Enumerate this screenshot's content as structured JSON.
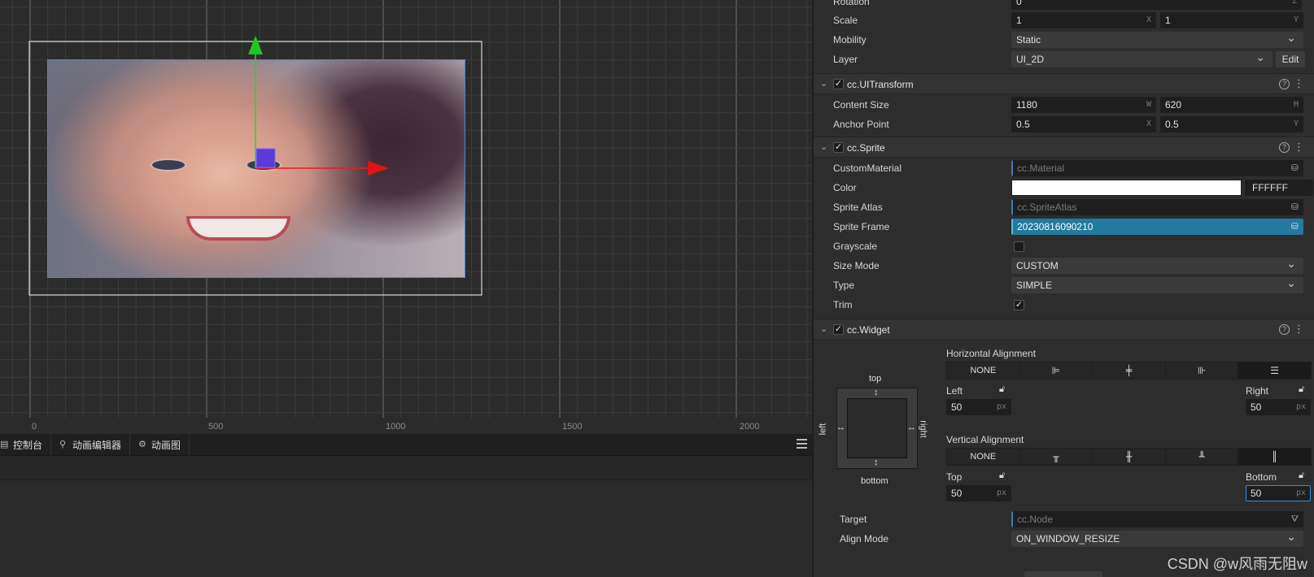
{
  "scene": {
    "ruler_labels": [
      "0",
      "500",
      "1000",
      "1500",
      "2000"
    ]
  },
  "bottom_panel": {
    "tabs": [
      {
        "label": "控制台",
        "icon": "console-icon"
      },
      {
        "label": "动画编辑器",
        "icon": "running-figure-icon"
      },
      {
        "label": "动画图",
        "icon": "animation-graph-icon"
      }
    ]
  },
  "inspector": {
    "node": {
      "rotation_label": "Rotation",
      "rotation_value": "0",
      "rotation_axis": "Z",
      "scale_label": "Scale",
      "scale_x": "1",
      "scale_y": "1",
      "mobility_label": "Mobility",
      "mobility_value": "Static",
      "layer_label": "Layer",
      "layer_value": "UI_2D",
      "layer_edit": "Edit"
    },
    "ui_transform": {
      "title": "cc.UITransform",
      "content_size_label": "Content Size",
      "width": "1180",
      "height": "620",
      "width_suffix": "W",
      "height_suffix": "H",
      "anchor_label": "Anchor Point",
      "anchor_x": "0.5",
      "anchor_y": "0.5"
    },
    "sprite": {
      "title": "cc.Sprite",
      "custom_material_label": "CustomMaterial",
      "custom_material_value": "cc.Material",
      "color_label": "Color",
      "color_hex": "FFFFFF",
      "sprite_atlas_label": "Sprite Atlas",
      "sprite_atlas_value": "cc.SpriteAtlas",
      "sprite_frame_label": "Sprite Frame",
      "sprite_frame_value": "20230816090210",
      "grayscale_label": "Grayscale",
      "size_mode_label": "Size Mode",
      "size_mode_value": "CUSTOM",
      "type_label": "Type",
      "type_value": "SIMPLE",
      "trim_label": "Trim"
    },
    "widget": {
      "title": "cc.Widget",
      "h_align_label": "Horizontal Alignment",
      "v_align_label": "Vertical Alignment",
      "none_label": "NONE",
      "left_label": "Left",
      "right_label": "Right",
      "top_label": "Top",
      "bottom_label": "Bottom",
      "left_value": "50",
      "right_value": "50",
      "top_value": "50",
      "bottom_value": "50",
      "px": "px",
      "diagram_top": "top",
      "diagram_bottom": "bottom",
      "diagram_left": "left",
      "diagram_right": "right",
      "target_label": "Target",
      "target_value": "cc.Node",
      "align_mode_label": "Align Mode",
      "align_mode_value": "ON_WINDOW_RESIZE"
    },
    "watermark": "CSDN @w风雨无阻w"
  }
}
